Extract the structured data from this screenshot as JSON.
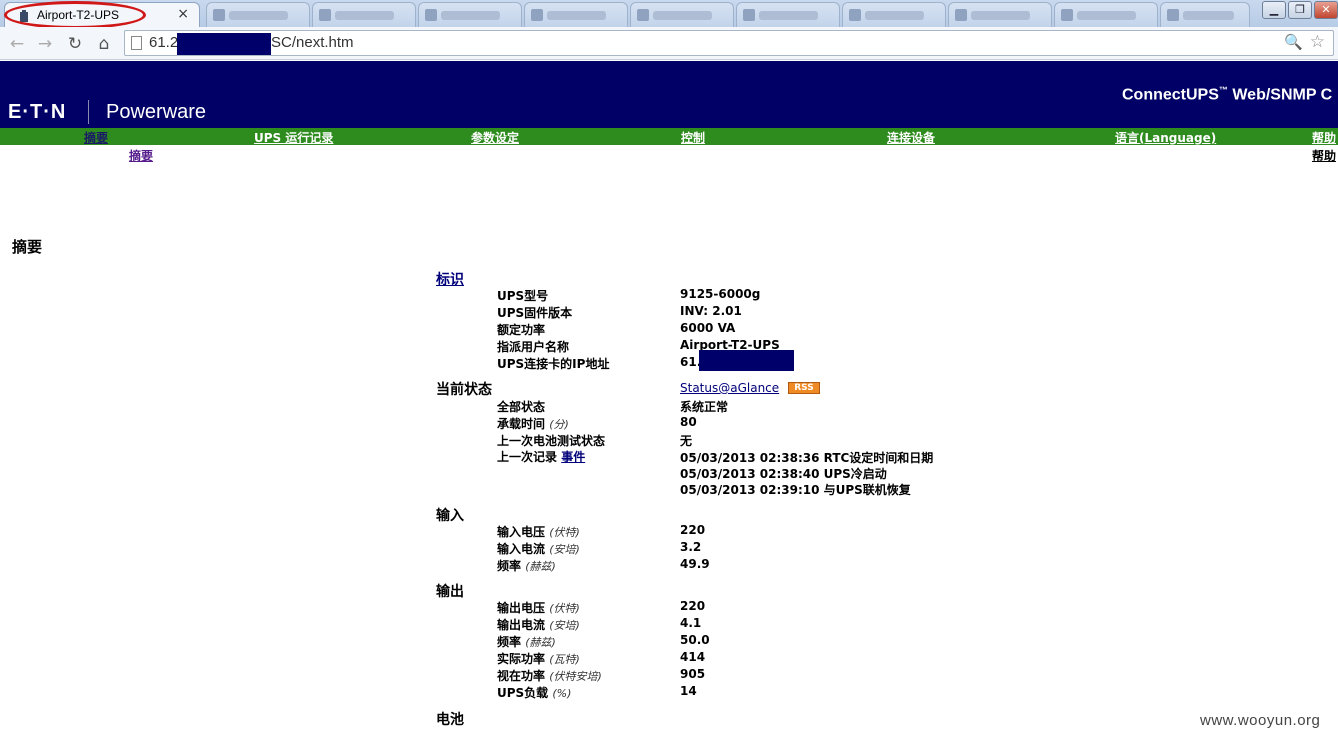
{
  "browser": {
    "active_tab_title": "Airport-T2-UPS",
    "tab_close": "×",
    "url_visible_start": "61.2",
    "url_visible_end": "SC/next.htm"
  },
  "header": {
    "brand": "E·T·N",
    "sub_brand": "Powerware",
    "product": "ConnectUPS",
    "product_tm": "™",
    "product_suffix": " Web/SNMP C"
  },
  "menu": [
    {
      "label": "摘要"
    },
    {
      "label": "UPS 运行记录"
    },
    {
      "label": "参数设定"
    },
    {
      "label": "控制"
    },
    {
      "label": "连接设备"
    },
    {
      "label": "语言(Language)"
    },
    {
      "label": "帮助"
    }
  ],
  "submenu": {
    "summary": "摘要",
    "help": "帮助"
  },
  "page_title": "摘要",
  "identity": {
    "heading": "标识",
    "rows": [
      {
        "label": "UPS型号",
        "value": "9125-6000g"
      },
      {
        "label": "UPS固件版本",
        "value": "INV: 2.01"
      },
      {
        "label": "额定功率",
        "value": "6000 VA"
      },
      {
        "label": "指派用户名称",
        "value": "Airport-T2-UPS"
      },
      {
        "label": "UPS连接卡的IP地址",
        "value": "61."
      }
    ]
  },
  "status": {
    "heading": "当前状态",
    "glance_link": "Status@aGlance",
    "rss": "RSS",
    "overall_label": "全部状态",
    "overall_value": "系统正常",
    "runtime_label": "承载时间",
    "runtime_unit": "(分)",
    "runtime_value": "80",
    "battery_test_label": "上一次电池测试状态",
    "battery_test_value": "无",
    "last_record_label": "上一次记录",
    "last_record_link": "事件",
    "events": [
      "05/03/2013 02:38:36 RTC设定时间和日期",
      "05/03/2013 02:38:40 UPS冷启动",
      "05/03/2013 02:39:10 与UPS联机恢复"
    ]
  },
  "input": {
    "heading": "输入",
    "rows": [
      {
        "label": "输入电压",
        "unit": "(伏特)",
        "value": "220"
      },
      {
        "label": "输入电流",
        "unit": "(安培)",
        "value": "3.2"
      },
      {
        "label": "频率",
        "unit": "(赫兹)",
        "value": "49.9"
      }
    ]
  },
  "output": {
    "heading": "输出",
    "rows": [
      {
        "label": "输出电压",
        "unit": "(伏特)",
        "value": "220"
      },
      {
        "label": "输出电流",
        "unit": "(安培)",
        "value": "4.1"
      },
      {
        "label": "频率",
        "unit": "(赫兹)",
        "value": "50.0"
      },
      {
        "label": "实际功率",
        "unit": "(瓦特)",
        "value": "414"
      },
      {
        "label": "视在功率",
        "unit": "(伏特安培)",
        "value": "905"
      },
      {
        "label": "UPS负载",
        "unit": "(%)",
        "value": "14"
      }
    ]
  },
  "battery": {
    "heading": "电池"
  },
  "watermark": "www.wooyun.org",
  "colors": {
    "banner": "#000066",
    "menu": "#2e8b1e",
    "highlight": "#d01818",
    "redaction": "#00006b"
  }
}
